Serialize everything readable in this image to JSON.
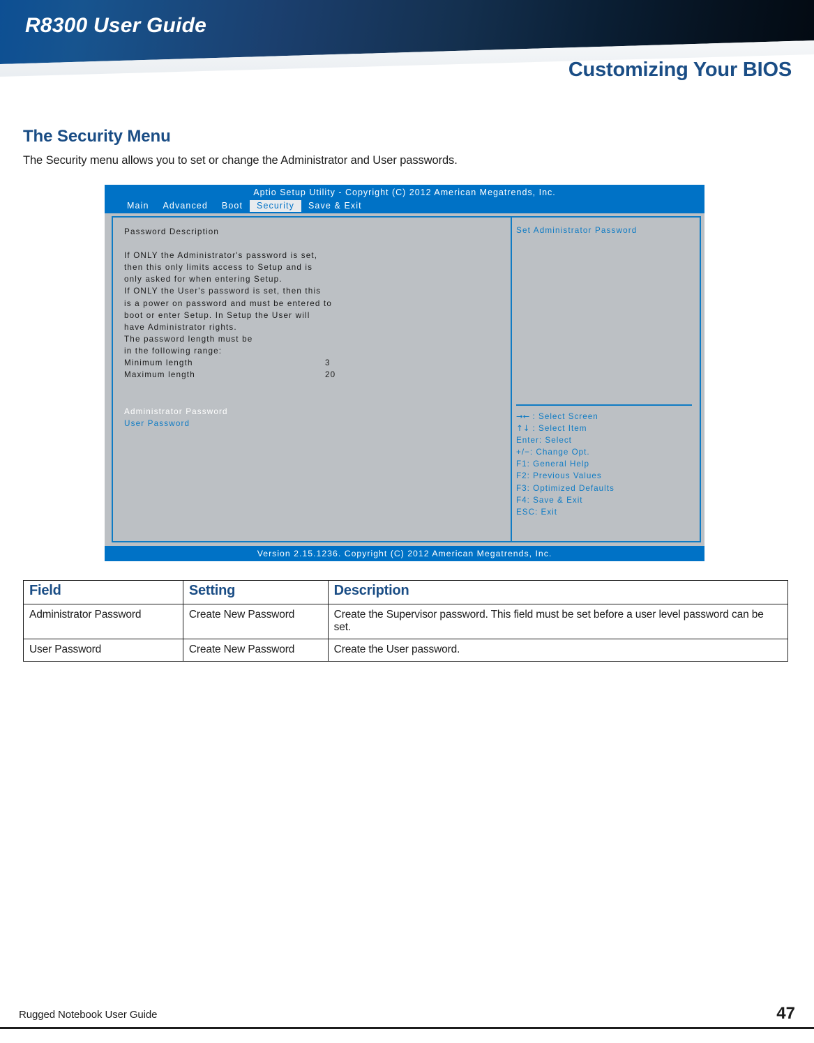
{
  "banner": {
    "guide_title": "R8300 User Guide",
    "section_title": "Customizing Your BIOS"
  },
  "content": {
    "heading": "The Security Menu",
    "intro": "The Security menu allows you to set or change the Administrator and User passwords."
  },
  "bios": {
    "title": "Aptio Setup Utility - Copyright (C) 2012 American Megatrends, Inc.",
    "tabs": [
      {
        "label": "Main",
        "active": false
      },
      {
        "label": "Advanced",
        "active": false
      },
      {
        "label": "Boot",
        "active": false
      },
      {
        "label": "Security",
        "active": true
      },
      {
        "label": "Save & Exit",
        "active": false
      }
    ],
    "left_panel": {
      "section_label": "Password Description",
      "description_lines": [
        "If ONLY the Administrator's password is set,",
        "then this only limits access to Setup and is",
        "only asked for when entering Setup.",
        "If ONLY the User's password is set, then this",
        "is a power on password and must be entered to",
        "boot or enter Setup. In Setup the User will",
        "have Administrator rights.",
        "The password length must be",
        "in the following range:"
      ],
      "min_length_label": "Minimum length",
      "min_length_value": "3",
      "max_length_label": "Maximum length",
      "max_length_value": "20",
      "admin_password_label": "Administrator Password",
      "user_password_label": "User Password"
    },
    "right_panel": {
      "help_title": "Set Administrator Password",
      "keys": [
        {
          "glyph": "→←",
          "text": ": Select Screen"
        },
        {
          "glyph": "↑↓",
          "text": ": Select Item"
        },
        {
          "glyph": "",
          "text": "Enter: Select"
        },
        {
          "glyph": "",
          "text": "+/−: Change Opt."
        },
        {
          "glyph": "",
          "text": "F1: General Help"
        },
        {
          "glyph": "",
          "text": "F2: Previous Values"
        },
        {
          "glyph": "",
          "text": "F3: Optimized Defaults"
        },
        {
          "glyph": "",
          "text": "F4: Save & Exit"
        },
        {
          "glyph": "",
          "text": "ESC: Exit"
        }
      ]
    },
    "footer": "Version 2.15.1236. Copyright (C) 2012 American Megatrends, Inc."
  },
  "table": {
    "headers": [
      "Field",
      "Setting",
      "Description"
    ],
    "rows": [
      {
        "field": "Administrator Password",
        "setting": "Create New Password",
        "description": "Create the Supervisor password. This field must be set before a user level password can be set."
      },
      {
        "field": "User Password",
        "setting": "Create New Password",
        "description": "Create the User password."
      }
    ]
  },
  "page_footer": {
    "left": "Rugged Notebook User Guide",
    "page_number": "47"
  },
  "colors": {
    "brand_blue": "#1a4d85",
    "bios_blue": "#0072c6",
    "bios_accent": "#0f7bc4",
    "bios_bg": "#bcc0c4"
  }
}
